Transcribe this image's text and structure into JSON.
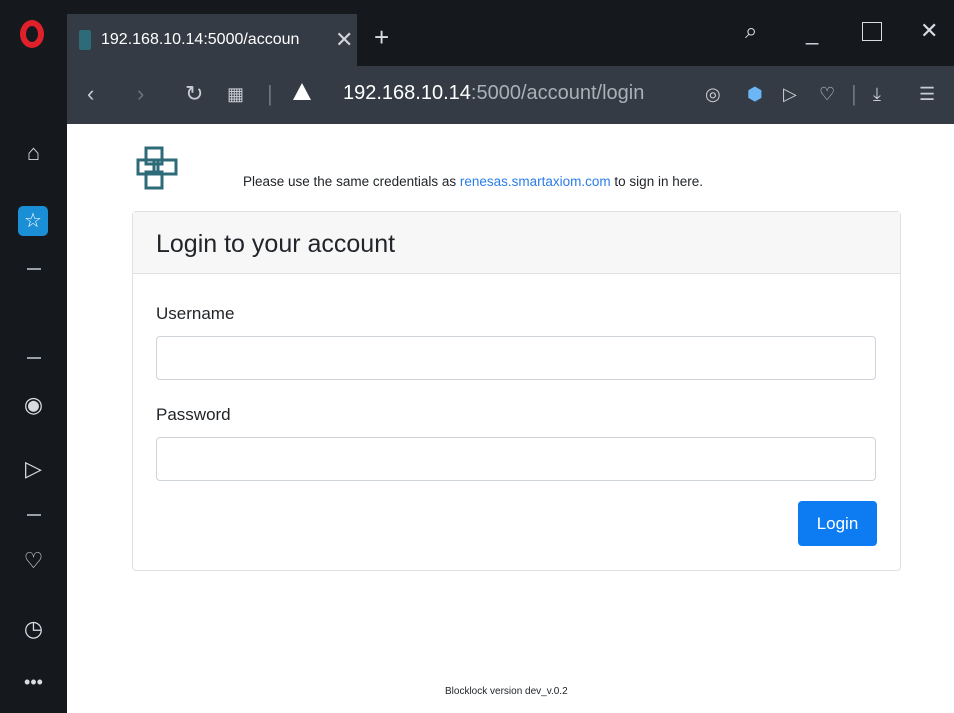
{
  "tab": {
    "title": "192.168.10.14:5000/accoun"
  },
  "address": {
    "host": "192.168.10.14",
    "path": ":5000/account/login"
  },
  "page": {
    "notice_prefix": "Please use the same credentials as ",
    "notice_link": "renesas.smartaxiom.com",
    "notice_suffix": " to sign in here.",
    "card_title": "Login to your account",
    "username_label": "Username",
    "username_value": "",
    "password_label": "Password",
    "password_value": "",
    "login_button": "Login",
    "footer": "Blocklock version dev_v.0.2"
  },
  "colors": {
    "accent": "#0d7cf2",
    "link": "#2b7de9",
    "opera_red": "#e0202b",
    "chrome_dark": "#15191e",
    "chrome_mid": "#343b44"
  },
  "icons": [
    "opera-logo-icon",
    "close-icon",
    "plus-icon",
    "search-icon",
    "minimize-icon",
    "maximize-icon",
    "back-icon",
    "forward-icon",
    "reload-icon",
    "grid-icon",
    "warning-icon",
    "camera-icon",
    "shield-icon",
    "send-icon",
    "heart-icon",
    "download-icon",
    "settings-icon",
    "home-icon",
    "speed-dial-icon",
    "player-icon",
    "history-icon",
    "more-icon"
  ]
}
